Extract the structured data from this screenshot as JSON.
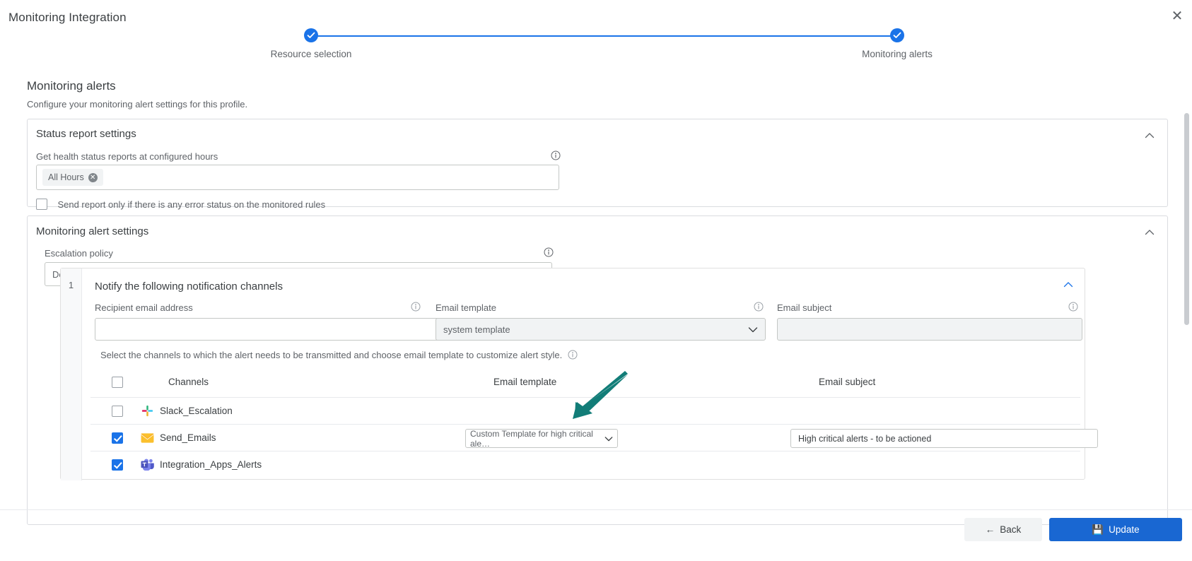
{
  "window": {
    "title": "Monitoring Integration",
    "close_label": "✕"
  },
  "stepper": {
    "steps": [
      {
        "label": "Resource selection",
        "state": "complete"
      },
      {
        "label": "Monitoring alerts",
        "state": "complete"
      }
    ]
  },
  "section": {
    "title": "Monitoring alerts",
    "subtitle": "Configure your monitoring alert settings for this profile."
  },
  "status_report": {
    "title": "Status report settings",
    "hours_label": "Get health status reports at configured hours",
    "hours_chip": "All Hours",
    "chip_remove": "✕",
    "error_only_label": "Send report only if there is any error status on the monitored rules",
    "error_only_checked": false
  },
  "alert_settings": {
    "title": "Monitoring alert settings",
    "escalation_label": "Escalation policy",
    "escalation_value": "Default Escalation Policy",
    "notify": {
      "index": "1",
      "title": "Notify the following notification channels",
      "recipient_label": "Recipient email address",
      "recipient_value": "",
      "email_template_label": "Email template",
      "email_template_value": "system template",
      "email_subject_label": "Email subject",
      "email_subject_value": "",
      "helper_text": "Select the channels to which the alert needs to be transmitted and choose email template to customize alert style.",
      "table": {
        "headers": [
          "Channels",
          "Email template",
          "Email subject"
        ],
        "header_checkbox_checked": false,
        "rows": [
          {
            "checked": false,
            "icon": "slack-icon",
            "name": "Slack_Escalation",
            "email_template": "",
            "email_subject": ""
          },
          {
            "checked": true,
            "icon": "gmail-icon",
            "name": "Send_Emails",
            "email_template": "Custom Template for high critical ale…",
            "email_subject": "High critical alerts - to be actioned"
          },
          {
            "checked": true,
            "icon": "teams-icon",
            "name": "Integration_Apps_Alerts",
            "email_template": "",
            "email_subject": ""
          }
        ]
      }
    }
  },
  "footer": {
    "back_label": "Back",
    "back_icon": "arrow-left-icon",
    "update_label": "Update",
    "update_icon": "save-icon"
  },
  "colors": {
    "accent": "#1a73e8",
    "primary_button": "#1967d2",
    "annotation_arrow": "#127d78"
  }
}
